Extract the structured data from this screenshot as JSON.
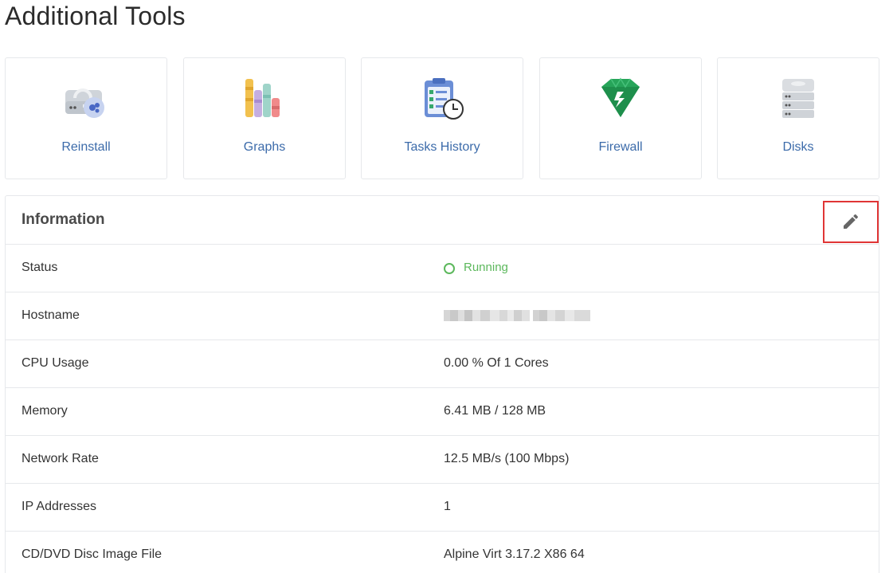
{
  "page": {
    "title": "Additional Tools"
  },
  "tools": [
    {
      "label": "Reinstall",
      "icon": "reinstall-icon"
    },
    {
      "label": "Graphs",
      "icon": "graphs-icon"
    },
    {
      "label": "Tasks History",
      "icon": "tasks-history-icon"
    },
    {
      "label": "Firewall",
      "icon": "firewall-icon"
    },
    {
      "label": "Disks",
      "icon": "disks-icon"
    }
  ],
  "information": {
    "title": "Information",
    "edit_icon": "pencil-icon",
    "rows": [
      {
        "label": "Status",
        "value": "Running"
      },
      {
        "label": "Hostname",
        "value": ""
      },
      {
        "label": "CPU Usage",
        "value": "0.00 % Of 1 Cores"
      },
      {
        "label": "Memory",
        "value": "6.41 MB / 128 MB"
      },
      {
        "label": "Network Rate",
        "value": "12.5 MB/s (100 Mbps)"
      },
      {
        "label": "IP Addresses",
        "value": "1"
      },
      {
        "label": "CD/DVD Disc Image File",
        "value": "Alpine Virt 3.17.2 X86 64"
      }
    ]
  },
  "colors": {
    "link": "#3c6baa",
    "status_running": "#5cb85c",
    "edit_highlight": "#e03535",
    "border": "#e6e8eb"
  }
}
